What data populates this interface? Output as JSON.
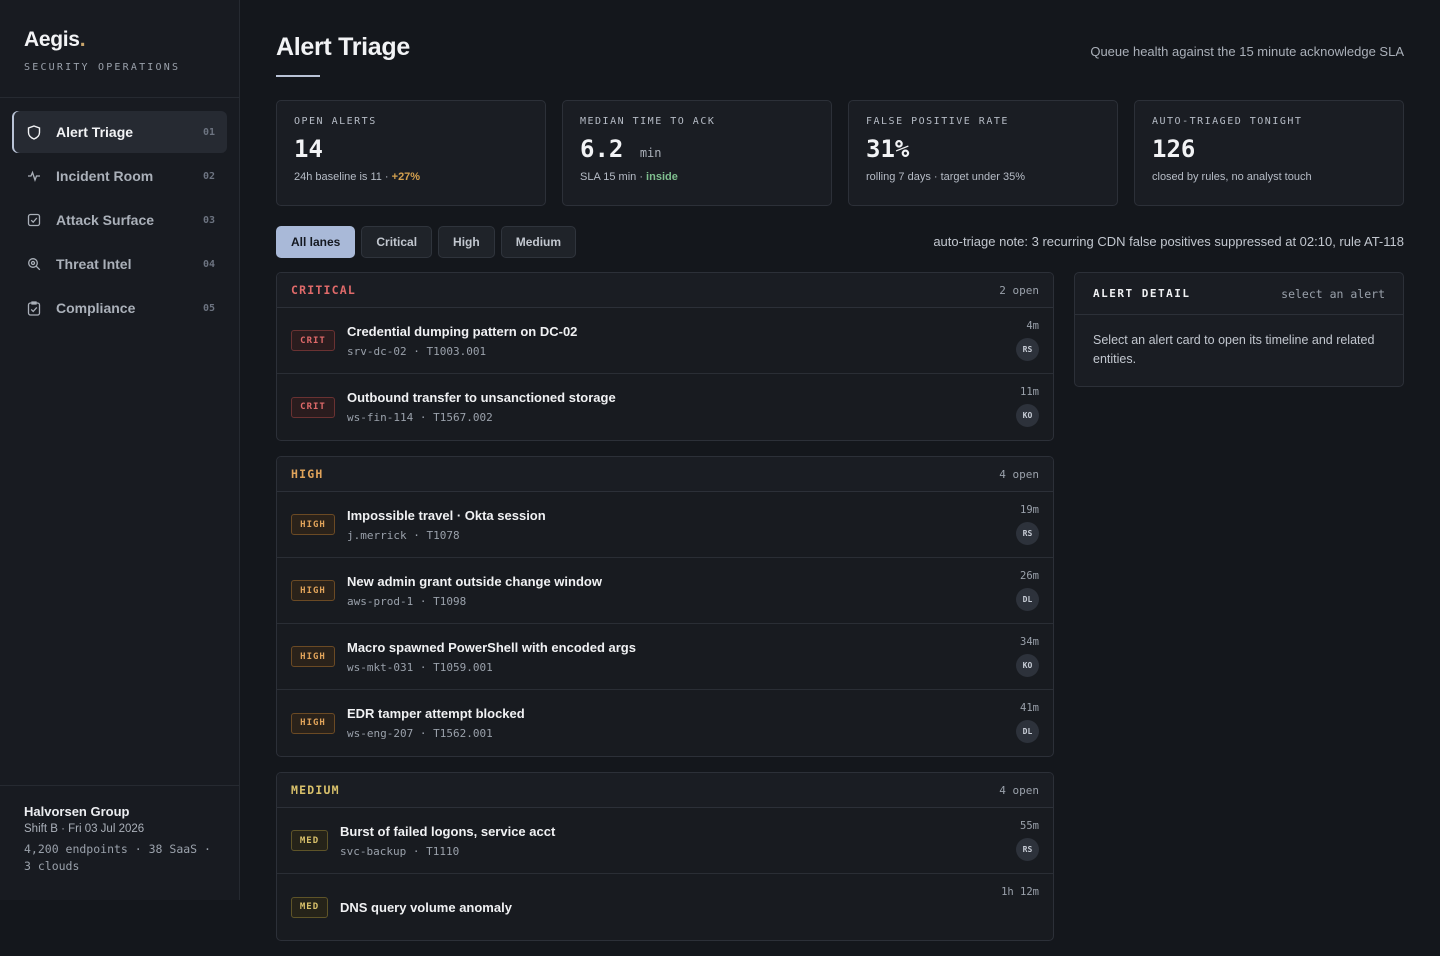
{
  "brand": {
    "name": "Aegis",
    "dot": ".",
    "subtitle": "SECURITY OPERATIONS"
  },
  "sidebar": {
    "items": [
      {
        "label": "Alert Triage",
        "num": "01",
        "icon": "shield-icon",
        "active": true
      },
      {
        "label": "Incident Room",
        "num": "02",
        "icon": "pulse-icon",
        "active": false
      },
      {
        "label": "Attack Surface",
        "num": "03",
        "icon": "checkbox-icon",
        "active": false
      },
      {
        "label": "Threat Intel",
        "num": "04",
        "icon": "search-icon",
        "active": false
      },
      {
        "label": "Compliance",
        "num": "05",
        "icon": "clipboard-check-icon",
        "active": false
      }
    ]
  },
  "org": {
    "name": "Halvorsen Group",
    "shift": "Shift B · Fri 03 Jul 2026",
    "stats": "4,200 endpoints · 38 SaaS · 3 clouds"
  },
  "header": {
    "title": "Alert Triage",
    "subtitle": "Queue health against the 15 minute acknowledge SLA"
  },
  "stats": [
    {
      "label": "OPEN ALERTS",
      "value": "14",
      "unit": "",
      "note": "24h baseline is 11 · ",
      "note_accent": "+27%",
      "accent_type": "delta"
    },
    {
      "label": "MEDIAN TIME TO ACK",
      "value": "6.2",
      "unit": "min",
      "note": "SLA 15 min · ",
      "note_accent": "inside",
      "accent_type": "ok"
    },
    {
      "label": "FALSE POSITIVE RATE",
      "value": "31%",
      "unit": "",
      "note": "rolling 7 days · target under 35%",
      "note_accent": "",
      "accent_type": ""
    },
    {
      "label": "AUTO-TRIAGED TONIGHT",
      "value": "126",
      "unit": "",
      "note": "closed by rules, no analyst touch",
      "note_accent": "",
      "accent_type": ""
    }
  ],
  "filters": {
    "options": [
      "All lanes",
      "Critical",
      "High",
      "Medium"
    ],
    "selected": "All lanes"
  },
  "triage_note": "auto-triage note: 3 recurring CDN false positives suppressed at 02:10, rule AT-118",
  "lanes": [
    {
      "name": "CRITICAL",
      "count": "2 open",
      "color": "#e06a6a",
      "sev": "CRIT",
      "sev_class": "crit",
      "alerts": [
        {
          "title": "Credential dumping pattern on DC-02",
          "meta": "srv-dc-02 · T1003.001",
          "age": "4m",
          "assignee": "RS"
        },
        {
          "title": "Outbound transfer to unsanctioned storage",
          "meta": "ws-fin-114 · T1567.002",
          "age": "11m",
          "assignee": "KO"
        }
      ]
    },
    {
      "name": "HIGH",
      "count": "4 open",
      "color": "#e0a35a",
      "sev": "HIGH",
      "sev_class": "high",
      "alerts": [
        {
          "title": "Impossible travel · Okta session",
          "meta": "j.merrick · T1078",
          "age": "19m",
          "assignee": "RS"
        },
        {
          "title": "New admin grant outside change window",
          "meta": "aws-prod-1 · T1098",
          "age": "26m",
          "assignee": "DL"
        },
        {
          "title": "Macro spawned PowerShell with encoded args",
          "meta": "ws-mkt-031 · T1059.001",
          "age": "34m",
          "assignee": "KO"
        },
        {
          "title": "EDR tamper attempt blocked",
          "meta": "ws-eng-207 · T1562.001",
          "age": "41m",
          "assignee": "DL"
        }
      ]
    },
    {
      "name": "MEDIUM",
      "count": "4 open",
      "color": "#d9c16b",
      "sev": "MED",
      "sev_class": "med",
      "alerts": [
        {
          "title": "Burst of failed logons, service acct",
          "meta": "svc-backup · T1110",
          "age": "55m",
          "assignee": "RS"
        },
        {
          "title": "DNS query volume anomaly",
          "meta": "",
          "age": "1h 12m",
          "assignee": ""
        }
      ]
    }
  ],
  "detail": {
    "title": "ALERT DETAIL",
    "hint": "select an alert",
    "body": "Select an alert card to open its timeline and related entities."
  }
}
